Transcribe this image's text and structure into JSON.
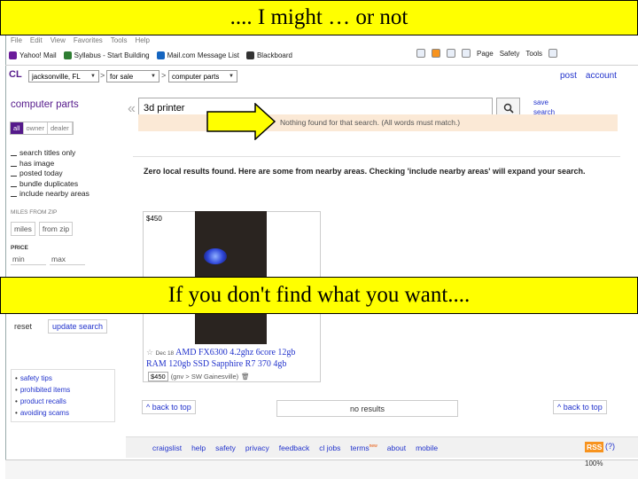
{
  "banners": {
    "top": ".... I might … or not",
    "middle": "If you don't find what you want...."
  },
  "browser": {
    "menu": [
      "File",
      "Edit",
      "View",
      "Favorites",
      "Tools",
      "Help"
    ],
    "favorites": [
      {
        "label": "Yahoo! Mail",
        "color": "#6a1b9a"
      },
      {
        "label": "Syllabus - Start Building",
        "color": "#2e7d32"
      },
      {
        "label": "Mail.com Message List",
        "color": "#1565c0"
      },
      {
        "label": "Blackboard",
        "color": "#333333"
      }
    ],
    "toolbar": {
      "page": "Page",
      "safety": "Safety",
      "tools": "Tools"
    },
    "zoom": "100%"
  },
  "craigslist": {
    "logo": "CL",
    "location": "jacksonville, FL",
    "section": "for sale",
    "category": "computer parts",
    "post": "post",
    "account": "account",
    "sidebar": {
      "title": "computer parts",
      "tabs": [
        "all",
        "owner",
        "dealer"
      ],
      "options": [
        "search titles only",
        "has image",
        "posted today",
        "bundle duplicates",
        "include nearby areas"
      ],
      "miles_label": "MILES FROM ZIP",
      "miles": "miles",
      "from_zip": "from zip",
      "price_label": "PRICE",
      "min": "min",
      "max": "max",
      "reset": "reset",
      "update": "update search",
      "help": [
        "safety tips",
        "prohibited items",
        "product recalls",
        "avoiding scams"
      ]
    },
    "search": {
      "query": "3d printer",
      "save": "save",
      "save2": "search",
      "not_found": "Nothing found for that search. (All words must match.)"
    },
    "zero_results": "Zero local results found. Here are some from nearby areas. Checking 'include nearby areas' will expand your search.",
    "result": {
      "price": "$450",
      "date": "Dec 18",
      "title": "AMD FX6300 4.2ghz 6core 12gb RAM 120gb SSD Sapphire R7 370 4gb",
      "meta_price": "$450",
      "meta_loc": "(gnv > SW Gainesville)"
    },
    "back_to_top": "^ back to top",
    "no_results": "no results",
    "footer": [
      "craigslist",
      "help",
      "safety",
      "privacy",
      "feedback",
      "cl jobs",
      "terms",
      "about",
      "mobile"
    ],
    "footer_new": "new",
    "rss": "RSS",
    "help_q": "(?)"
  },
  "colors": {
    "banner": "#ffff00",
    "link": "#2233cc",
    "cl_purple": "#551a8b",
    "notice": "#fbe9d6"
  }
}
